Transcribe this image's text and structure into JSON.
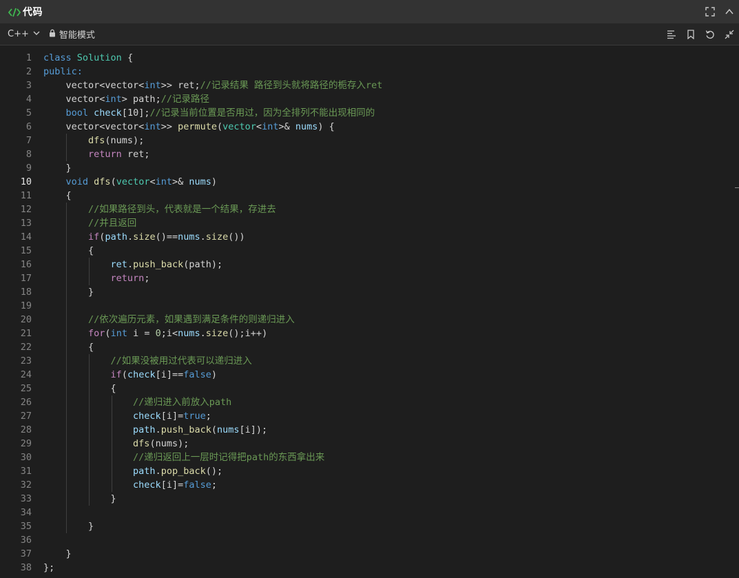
{
  "title": "代码",
  "toolbar": {
    "language": "C++",
    "mode": "智能模式"
  },
  "editor": {
    "active_line": 10,
    "lines": [
      [
        [
          "k",
          "class"
        ],
        [
          "p",
          " "
        ],
        [
          "t",
          "Solution"
        ],
        [
          "p",
          " {"
        ]
      ],
      [
        [
          "k",
          "public:"
        ]
      ],
      [
        [
          "p",
          "    vector<vector<"
        ],
        [
          "k",
          "int"
        ],
        [
          "p",
          ">> ret;"
        ],
        [
          "c",
          "//记录结果 路径到头就将路径的栀存入ret"
        ]
      ],
      [
        [
          "p",
          "    vector<"
        ],
        [
          "k",
          "int"
        ],
        [
          "p",
          "> path;"
        ],
        [
          "c",
          "//记录路径"
        ]
      ],
      [
        [
          "p",
          "    "
        ],
        [
          "k",
          "bool"
        ],
        [
          "p",
          " "
        ],
        [
          "v",
          "check"
        ],
        [
          "p",
          "[10];"
        ],
        [
          "c",
          "//记录当前位置是否用过，因为全排列不能出现相同的"
        ]
      ],
      [
        [
          "p",
          "    vector<vector<"
        ],
        [
          "k",
          "int"
        ],
        [
          "p",
          ">> "
        ],
        [
          "f",
          "permute"
        ],
        [
          "p",
          "("
        ],
        [
          "t",
          "vector"
        ],
        [
          "p",
          "<"
        ],
        [
          "k",
          "int"
        ],
        [
          "p",
          ">& "
        ],
        [
          "v",
          "nums"
        ],
        [
          "p",
          ") {"
        ]
      ],
      [
        [
          "p",
          "        "
        ],
        [
          "f",
          "dfs"
        ],
        [
          "p",
          "(nums);"
        ]
      ],
      [
        [
          "p",
          "        "
        ],
        [
          "ctl",
          "return"
        ],
        [
          "p",
          " ret;"
        ]
      ],
      [
        [
          "p",
          "    }"
        ]
      ],
      [
        [
          "p",
          "    "
        ],
        [
          "k",
          "void"
        ],
        [
          "p",
          " "
        ],
        [
          "f",
          "dfs"
        ],
        [
          "p",
          "("
        ],
        [
          "t",
          "vector"
        ],
        [
          "p",
          "<"
        ],
        [
          "k",
          "int"
        ],
        [
          "p",
          ">& "
        ],
        [
          "v",
          "nums"
        ],
        [
          "p",
          ")"
        ]
      ],
      [
        [
          "p",
          "    {"
        ]
      ],
      [
        [
          "c",
          "        //如果路径到头，代表就是一个结果，存进去"
        ]
      ],
      [
        [
          "c",
          "        //并且返回"
        ]
      ],
      [
        [
          "p",
          "        "
        ],
        [
          "ctl",
          "if"
        ],
        [
          "p",
          "("
        ],
        [
          "v",
          "path"
        ],
        [
          "p",
          "."
        ],
        [
          "f",
          "size"
        ],
        [
          "p",
          "()=="
        ],
        [
          "v",
          "nums"
        ],
        [
          "p",
          "."
        ],
        [
          "f",
          "size"
        ],
        [
          "p",
          "())"
        ]
      ],
      [
        [
          "p",
          "        {"
        ]
      ],
      [
        [
          "p",
          "            "
        ],
        [
          "v",
          "ret"
        ],
        [
          "p",
          "."
        ],
        [
          "f",
          "push_back"
        ],
        [
          "p",
          "(path);"
        ]
      ],
      [
        [
          "p",
          "            "
        ],
        [
          "ctl",
          "return"
        ],
        [
          "p",
          ";"
        ]
      ],
      [
        [
          "p",
          "        }"
        ]
      ],
      [
        [
          "p",
          ""
        ]
      ],
      [
        [
          "c",
          "        //依次遍历元素，如果遇到满足条件的则递归进入"
        ]
      ],
      [
        [
          "p",
          "        "
        ],
        [
          "ctl",
          "for"
        ],
        [
          "p",
          "("
        ],
        [
          "k",
          "int"
        ],
        [
          "p",
          " i = "
        ],
        [
          "n",
          "0"
        ],
        [
          "p",
          ";i<"
        ],
        [
          "v",
          "nums"
        ],
        [
          "p",
          "."
        ],
        [
          "f",
          "size"
        ],
        [
          "p",
          "();i++)"
        ]
      ],
      [
        [
          "p",
          "        {"
        ]
      ],
      [
        [
          "c",
          "            //如果没被用过代表可以递归进入"
        ]
      ],
      [
        [
          "p",
          "            "
        ],
        [
          "ctl",
          "if"
        ],
        [
          "p",
          "("
        ],
        [
          "v",
          "check"
        ],
        [
          "p",
          "[i]=="
        ],
        [
          "k",
          "false"
        ],
        [
          "p",
          ")"
        ]
      ],
      [
        [
          "p",
          "            {"
        ]
      ],
      [
        [
          "c",
          "                //递归进入前放入path"
        ]
      ],
      [
        [
          "p",
          "                "
        ],
        [
          "v",
          "check"
        ],
        [
          "p",
          "[i]="
        ],
        [
          "k",
          "true"
        ],
        [
          "p",
          ";"
        ]
      ],
      [
        [
          "p",
          "                "
        ],
        [
          "v",
          "path"
        ],
        [
          "p",
          "."
        ],
        [
          "f",
          "push_back"
        ],
        [
          "p",
          "("
        ],
        [
          "v",
          "nums"
        ],
        [
          "p",
          "[i]);"
        ]
      ],
      [
        [
          "p",
          "                "
        ],
        [
          "f",
          "dfs"
        ],
        [
          "p",
          "(nums);"
        ]
      ],
      [
        [
          "c",
          "                //递归返回上一层时记得把path的东西拿出来"
        ]
      ],
      [
        [
          "p",
          "                "
        ],
        [
          "v",
          "path"
        ],
        [
          "p",
          "."
        ],
        [
          "f",
          "pop_back"
        ],
        [
          "p",
          "();"
        ]
      ],
      [
        [
          "p",
          "                "
        ],
        [
          "v",
          "check"
        ],
        [
          "p",
          "[i]="
        ],
        [
          "k",
          "false"
        ],
        [
          "p",
          ";"
        ]
      ],
      [
        [
          "p",
          "            }"
        ]
      ],
      [
        [
          "p",
          ""
        ]
      ],
      [
        [
          "p",
          "        }"
        ]
      ],
      [
        [
          "p",
          ""
        ]
      ],
      [
        [
          "p",
          "    }"
        ]
      ],
      [
        [
          "p",
          "};"
        ]
      ]
    ]
  }
}
